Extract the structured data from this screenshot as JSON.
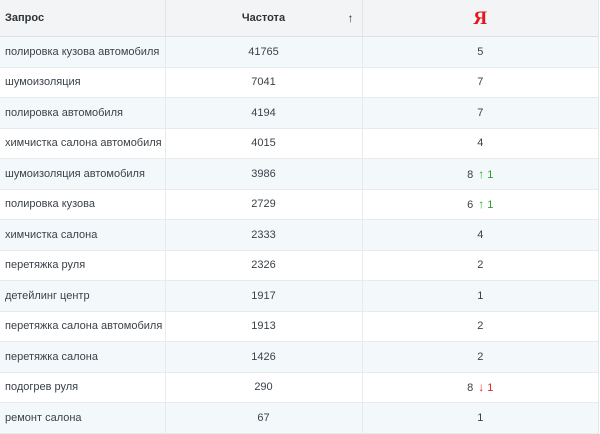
{
  "header": {
    "query_label": "Запрос",
    "frequency_label": "Частота",
    "sort_indicator": "↑",
    "yandex_logo_text": "Я"
  },
  "colors": {
    "header_bg": "#f2f4f5",
    "stripe_bg": "#f3f9fb",
    "yandex_red": "#e8141c",
    "up_green": "#2e9d2e",
    "down_red": "#e0262b"
  },
  "rows": [
    {
      "query": "полировка кузова автомобиля",
      "frequency": "41765",
      "position": "5",
      "change_dir": "",
      "change_arrow": "",
      "change": ""
    },
    {
      "query": "шумоизоляция",
      "frequency": "7041",
      "position": "7",
      "change_dir": "",
      "change_arrow": "",
      "change": ""
    },
    {
      "query": "полировка автомобиля",
      "frequency": "4194",
      "position": "7",
      "change_dir": "",
      "change_arrow": "",
      "change": ""
    },
    {
      "query": "химчистка салона автомобиля",
      "frequency": "4015",
      "position": "4",
      "change_dir": "",
      "change_arrow": "",
      "change": ""
    },
    {
      "query": "шумоизоляция автомобиля",
      "frequency": "3986",
      "position": "8",
      "change_dir": "up",
      "change_arrow": "↑",
      "change": "1"
    },
    {
      "query": "полировка кузова",
      "frequency": "2729",
      "position": "6",
      "change_dir": "up",
      "change_arrow": "↑",
      "change": "1"
    },
    {
      "query": "химчистка салона",
      "frequency": "2333",
      "position": "4",
      "change_dir": "",
      "change_arrow": "",
      "change": ""
    },
    {
      "query": "перетяжка руля",
      "frequency": "2326",
      "position": "2",
      "change_dir": "",
      "change_arrow": "",
      "change": ""
    },
    {
      "query": "детейлинг центр",
      "frequency": "1917",
      "position": "1",
      "change_dir": "",
      "change_arrow": "",
      "change": ""
    },
    {
      "query": "перетяжка салона автомобиля",
      "frequency": "1913",
      "position": "2",
      "change_dir": "",
      "change_arrow": "",
      "change": ""
    },
    {
      "query": "перетяжка салона",
      "frequency": "1426",
      "position": "2",
      "change_dir": "",
      "change_arrow": "",
      "change": ""
    },
    {
      "query": "подогрев руля",
      "frequency": "290",
      "position": "8",
      "change_dir": "down",
      "change_arrow": "↓",
      "change": "1"
    },
    {
      "query": "ремонт салона",
      "frequency": "67",
      "position": "1",
      "change_dir": "",
      "change_arrow": "",
      "change": ""
    }
  ]
}
